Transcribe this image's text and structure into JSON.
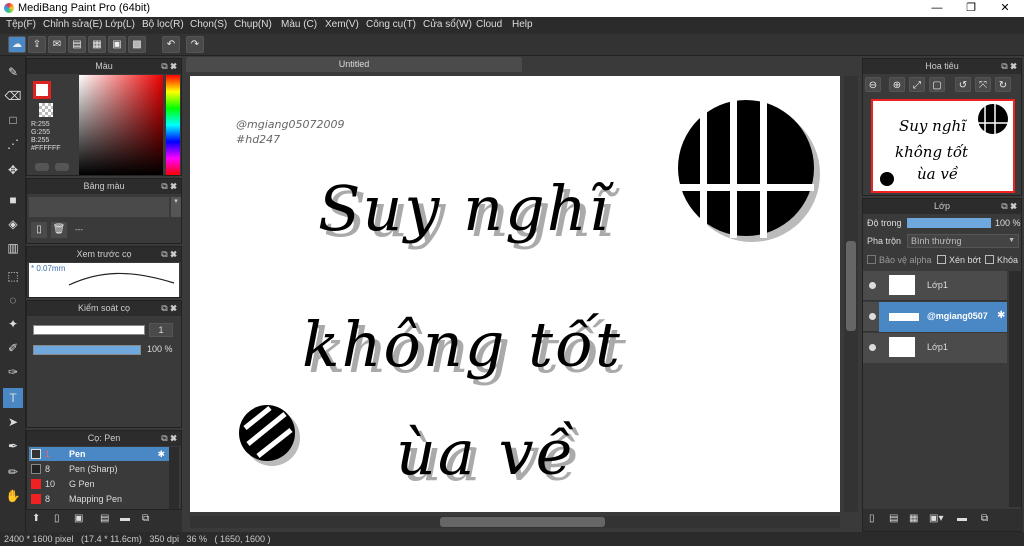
{
  "titlebar": {
    "title": "MediBang Paint Pro (64bit)",
    "min": "—",
    "max": "❐",
    "close": "✕"
  },
  "menu": [
    "Tệp(F)",
    "Chỉnh sửa(E)",
    "Lớp(L)",
    "Bộ lọc(R)",
    "Chọn(S)",
    "Chụp(N)",
    "Màu (C)",
    "Xem(V)",
    "Công cụ(T)",
    "Cửa sổ(W)",
    "Cloud",
    "Help"
  ],
  "panels": {
    "color": {
      "title": "Màu",
      "r": "R:255",
      "g": "G:255",
      "b": "B:255",
      "hex": "#FFFFFF"
    },
    "palette": {
      "title": "Bảng màu",
      "dash": "---"
    },
    "brush_preview": {
      "title": "Xem trước cọ",
      "size": "* 0.07mm"
    },
    "brush_control": {
      "title": "Kiểm soát cọ",
      "size_value": "1",
      "opacity_value": "100 %"
    },
    "brush": {
      "title": "Cọ: Pen",
      "items": [
        {
          "size": "1",
          "name": "Pen"
        },
        {
          "size": "8",
          "name": "Pen (Sharp)"
        },
        {
          "size": "10",
          "name": "G Pen"
        },
        {
          "size": "8",
          "name": "Mapping Pen"
        }
      ]
    }
  },
  "canvas": {
    "tab": "Untitled",
    "watermark1": "@mgiang05072009",
    "watermark2": "#hd247",
    "line1": "Suy nghĩ",
    "line2": "không tốt",
    "line3": "ùa về"
  },
  "navigator": {
    "title": "Hoa tiêu",
    "line1": "Suy nghĩ",
    "line2": "không tốt",
    "line3": "ùa về"
  },
  "layers": {
    "title": "Lớp",
    "opacity_label": "Độ trong",
    "opacity_value": "100 %",
    "blend_label": "Pha trộn",
    "blend_value": "Bình thường",
    "protect_alpha": "Bảo vệ alpha",
    "clipping": "Xén bớt",
    "lock": "Khóa",
    "items": [
      {
        "name": "Lớp1"
      },
      {
        "name": "@mgiang0507"
      },
      {
        "name": "Lớp1"
      }
    ]
  },
  "status": {
    "text": "2400 * 1600 pixel   (17.4 * 11.6cm)   350 dpi   36 %   ( 1650, 1600 )"
  }
}
